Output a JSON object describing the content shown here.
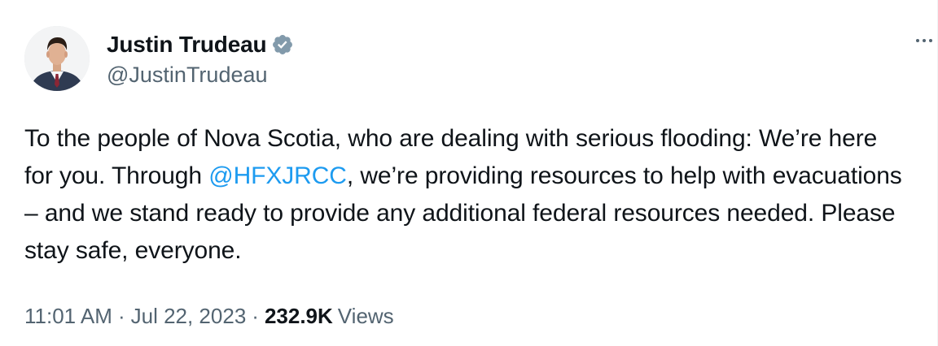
{
  "user": {
    "display_name": "Justin Trudeau",
    "handle": "@JustinTrudeau",
    "verified": true,
    "verified_color": "#829aab",
    "avatar_icon": "profile-photo"
  },
  "tweet": {
    "text_part1": "To the people of Nova Scotia, who are dealing with serious flooding: We’re here for you. Through ",
    "mention": "@HFXJRCC",
    "text_part2": ", we’re providing resources to help with evacuations – and we stand ready to provide any additional federal resources needed. Please stay safe, everyone.",
    "mention_color": "#1d9bf0"
  },
  "meta": {
    "time": "11:01 AM",
    "separator": "·",
    "date": "Jul 22, 2023",
    "views_count": "232.9K",
    "views_label": "Views"
  },
  "more_icon": "ellipsis-icon"
}
